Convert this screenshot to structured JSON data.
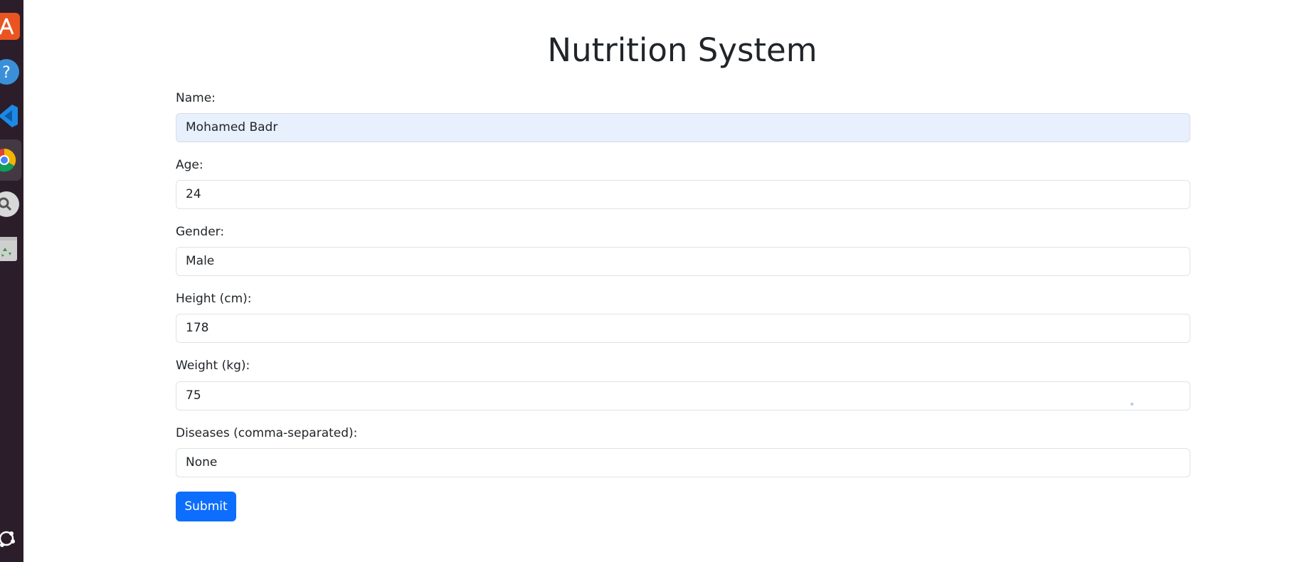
{
  "page": {
    "title": "Nutrition System"
  },
  "form": {
    "name": {
      "label": "Name:",
      "value": "Mohamed Badr"
    },
    "age": {
      "label": "Age:",
      "value": "24"
    },
    "gender": {
      "label": "Gender:",
      "value": "Male"
    },
    "height": {
      "label": "Height (cm):",
      "value": "178"
    },
    "weight": {
      "label": "Weight (kg):",
      "value": "75"
    },
    "diseases": {
      "label": "Diseases (comma-separated):",
      "value": "None"
    },
    "submit_label": "Submit"
  },
  "dock": {
    "items": [
      {
        "icon": "software-center-icon",
        "color": "#e95420"
      },
      {
        "icon": "help-icon",
        "color": "#3b8fd9"
      },
      {
        "icon": "vscode-icon",
        "color": "#1e88e5"
      },
      {
        "icon": "chrome-icon",
        "color": "#db4437"
      },
      {
        "icon": "disk-icon",
        "color": "#d8d8d8"
      },
      {
        "icon": "trash-icon",
        "color": "#cfcfcf"
      },
      {
        "icon": "show-apps-icon",
        "color": "#ffffff"
      }
    ]
  },
  "colors": {
    "primary": "#0d6efd",
    "autofill_bg": "#e8f0fe",
    "dock_bg": "#2b1e2a"
  }
}
